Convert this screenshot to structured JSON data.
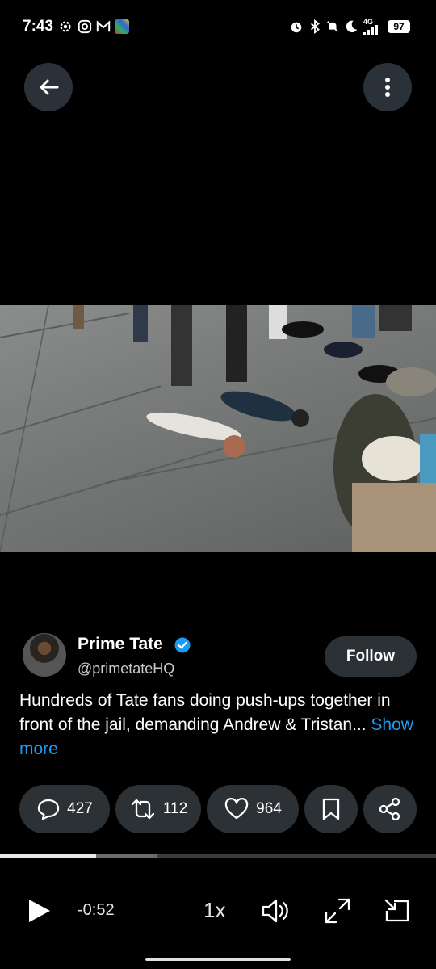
{
  "status_bar": {
    "time": "7:43",
    "network": "4G",
    "battery": "97"
  },
  "author": {
    "name": "Prime Tate",
    "handle": "@primetateHQ",
    "verified": true,
    "follow_label": "Follow"
  },
  "tweet": {
    "text": "Hundreds of Tate fans doing push-ups together in front of the jail, demanding Andrew & Tristan...",
    "show_more": "Show more"
  },
  "actions": {
    "replies": "427",
    "reposts": "112",
    "likes": "964"
  },
  "player": {
    "time_remaining": "-0:52",
    "speed": "1x",
    "progress_fraction": 0.22,
    "buffered_fraction": 0.36
  },
  "colors": {
    "accent": "#1d9bf0",
    "pill_bg": "#2c3136",
    "background": "#000000"
  },
  "icons": [
    "settings-icon",
    "instagram-icon",
    "gmail-icon",
    "alarm-icon",
    "bluetooth-icon",
    "bell-off-icon",
    "moon-icon",
    "signal-icon",
    "back-arrow-icon",
    "more-vertical-icon",
    "verified-badge-icon",
    "reply-icon",
    "repost-icon",
    "like-icon",
    "bookmark-icon",
    "share-icon",
    "play-icon",
    "volume-icon",
    "fullscreen-icon",
    "pip-icon"
  ]
}
